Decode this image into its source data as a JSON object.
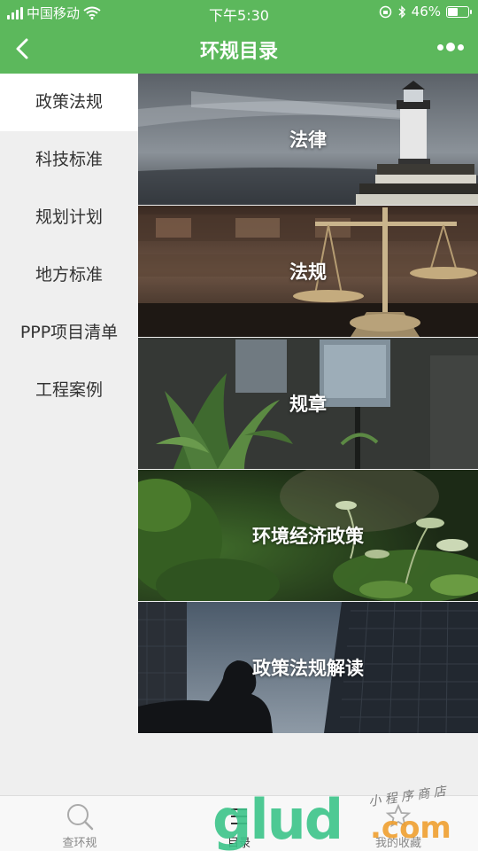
{
  "status_bar": {
    "carrier": "中国移动",
    "time": "下午5:30",
    "battery": "46%",
    "battery_level": 0.46
  },
  "nav": {
    "title": "环规目录"
  },
  "sidebar": {
    "items": [
      {
        "label": "政策法规",
        "active": true
      },
      {
        "label": "科技标准",
        "active": false
      },
      {
        "label": "规划计划",
        "active": false
      },
      {
        "label": "地方标准",
        "active": false
      },
      {
        "label": "PPP项目清单",
        "active": false
      },
      {
        "label": "工程案例",
        "active": false
      }
    ]
  },
  "cards": [
    {
      "label": "法律"
    },
    {
      "label": "法规"
    },
    {
      "label": "规章"
    },
    {
      "label": "环境经济政策"
    },
    {
      "label": "政策法规解读"
    }
  ],
  "tab_bar": {
    "tabs": [
      {
        "label": "查环规",
        "icon": "search-icon"
      },
      {
        "label": "目录",
        "icon": "list-icon"
      },
      {
        "label": "我的收藏",
        "icon": "favorite-icon"
      }
    ]
  },
  "watermark": {
    "big": "glud",
    "com": ".com",
    "small": "小 程 序 商 店"
  }
}
